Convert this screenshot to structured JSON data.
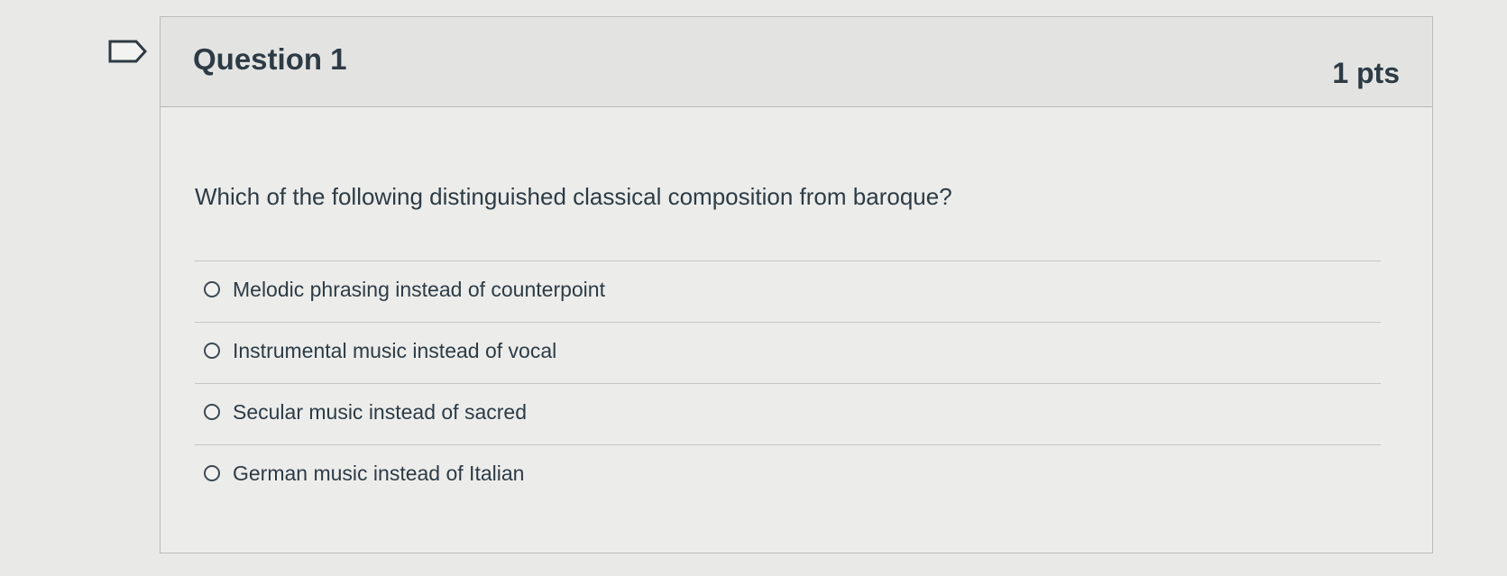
{
  "icons": {
    "flag": "flag-icon"
  },
  "question": {
    "title": "Question 1",
    "points": "1 pts",
    "text": "Which of the following distinguished classical composition from baroque?",
    "answers": [
      "Melodic phrasing instead of counterpoint",
      "Instrumental music instead of vocal",
      "Secular music instead of sacred",
      "German music instead of Italian"
    ]
  },
  "colors": {
    "background": "#e9e9e7",
    "card_background": "#ecedeb",
    "header_background": "#e3e4e2",
    "text": "#2d3b45",
    "border": "#b9bcbc"
  }
}
